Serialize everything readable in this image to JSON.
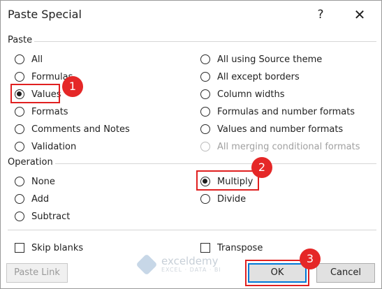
{
  "dialog": {
    "title": "Paste Special",
    "help_label": "?",
    "close_label": "✕"
  },
  "paste": {
    "heading": "Paste",
    "left": [
      {
        "label": "All",
        "checked": false,
        "disabled": false
      },
      {
        "label": "Formulas",
        "checked": false,
        "disabled": false
      },
      {
        "label": "Values",
        "checked": true,
        "disabled": false
      },
      {
        "label": "Formats",
        "checked": false,
        "disabled": false
      },
      {
        "label": "Comments and Notes",
        "checked": false,
        "disabled": false
      },
      {
        "label": "Validation",
        "checked": false,
        "disabled": false
      }
    ],
    "right": [
      {
        "label": "All using Source theme",
        "checked": false,
        "disabled": false
      },
      {
        "label": "All except borders",
        "checked": false,
        "disabled": false
      },
      {
        "label": "Column widths",
        "checked": false,
        "disabled": false
      },
      {
        "label": "Formulas and number formats",
        "checked": false,
        "disabled": false
      },
      {
        "label": "Values and number formats",
        "checked": false,
        "disabled": false
      },
      {
        "label": "All merging conditional formats",
        "checked": false,
        "disabled": true
      }
    ]
  },
  "operation": {
    "heading": "Operation",
    "left": [
      {
        "label": "None",
        "checked": false
      },
      {
        "label": "Add",
        "checked": false
      },
      {
        "label": "Subtract",
        "checked": false
      }
    ],
    "right": [
      {
        "label": "Multiply",
        "checked": true
      },
      {
        "label": "Divide",
        "checked": false
      }
    ]
  },
  "options": {
    "skip_blanks": {
      "label": "Skip blanks",
      "checked": false
    },
    "transpose": {
      "label": "Transpose",
      "checked": false
    }
  },
  "buttons": {
    "paste_link": "Paste Link",
    "ok": "OK",
    "cancel": "Cancel"
  },
  "annotations": {
    "badge_1": "1",
    "badge_2": "2",
    "badge_3": "3",
    "highlight_color": "#e02020",
    "badge_color": "#e52727"
  },
  "watermark": {
    "name": "exceldemy",
    "tagline": "EXCEL · DATA · BI"
  }
}
